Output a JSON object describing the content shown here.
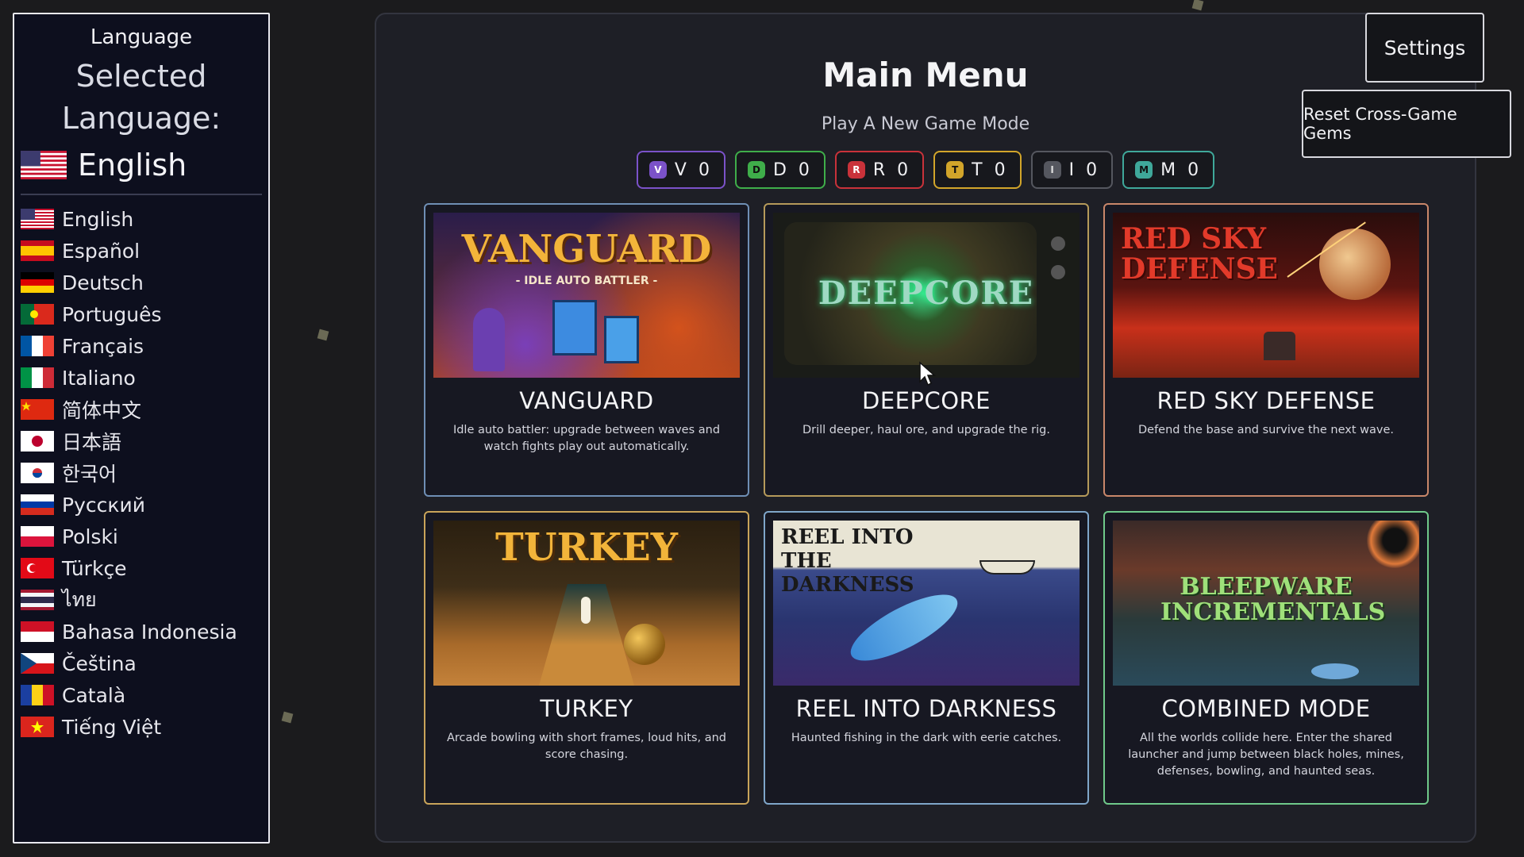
{
  "language_panel": {
    "title": "Language",
    "selected_label": "Selected Language:",
    "current": "English",
    "items": [
      {
        "label": "English",
        "flag": "us"
      },
      {
        "label": "Español",
        "flag": "es"
      },
      {
        "label": "Deutsch",
        "flag": "de"
      },
      {
        "label": "Português",
        "flag": "pt"
      },
      {
        "label": "Français",
        "flag": "fr"
      },
      {
        "label": "Italiano",
        "flag": "it"
      },
      {
        "label": "简体中文",
        "flag": "cn"
      },
      {
        "label": "日本語",
        "flag": "jp"
      },
      {
        "label": "한국어",
        "flag": "kr"
      },
      {
        "label": "Русский",
        "flag": "ru"
      },
      {
        "label": "Polski",
        "flag": "pl"
      },
      {
        "label": "Türkçe",
        "flag": "tr"
      },
      {
        "label": "ไทย",
        "flag": "th"
      },
      {
        "label": "Bahasa Indonesia",
        "flag": "id"
      },
      {
        "label": "Čeština",
        "flag": "cz"
      },
      {
        "label": "Català",
        "flag": "ca"
      },
      {
        "label": "Tiếng Việt",
        "flag": "vn"
      }
    ]
  },
  "main": {
    "title": "Main Menu",
    "subtitle": "Play A New Game Mode",
    "gems": [
      {
        "letter": "V",
        "count": "V 0",
        "color": "#7b52c9"
      },
      {
        "letter": "D",
        "count": "D 0",
        "color": "#3fae4a"
      },
      {
        "letter": "R",
        "count": "R 0",
        "color": "#c9323a"
      },
      {
        "letter": "T",
        "count": "T 0",
        "color": "#d2a52a"
      },
      {
        "letter": "I",
        "count": "I 0",
        "color": "#55575f"
      },
      {
        "letter": "M",
        "count": "M 0",
        "color": "#3fa89a"
      }
    ],
    "cards": [
      {
        "art_title": "VANGUARD",
        "art_subtitle": "- IDLE AUTO BATTLER -",
        "name": "VANGUARD",
        "desc": "Idle auto battler: upgrade between waves and watch fights play out automatically.",
        "border": "#6f8fb5"
      },
      {
        "art_title": "DEEPCORE",
        "art_subtitle": "",
        "name": "DEEPCORE",
        "desc": "Drill deeper, haul ore, and upgrade the rig.",
        "border": "#b59a5a"
      },
      {
        "art_title": "RED SKY DEFENSE",
        "art_subtitle": "",
        "name": "RED SKY DEFENSE",
        "desc": "Defend the base and survive the next wave.",
        "border": "#c9876a"
      },
      {
        "art_title": "TURKEY",
        "art_subtitle": "",
        "name": "TURKEY",
        "desc": "Arcade bowling with short frames, loud hits, and score chasing.",
        "border": "#c9a45a"
      },
      {
        "art_title": "REEL INTO THE DARKNESS",
        "art_subtitle": "",
        "name": "REEL INTO DARKNESS",
        "desc": "Haunted fishing in the dark with eerie catches.",
        "border": "#7fa6c9"
      },
      {
        "art_title": "BLEEPWARE INCREMENTALS",
        "art_subtitle": "",
        "name": "COMBINED MODE",
        "desc": "All the worlds collide here. Enter the shared launcher and jump between black holes, mines, defenses, bowling, and haunted seas.",
        "border": "#6fc98a"
      }
    ]
  },
  "buttons": {
    "settings": "Settings",
    "reset_gems": "Reset Cross-Game Gems"
  }
}
